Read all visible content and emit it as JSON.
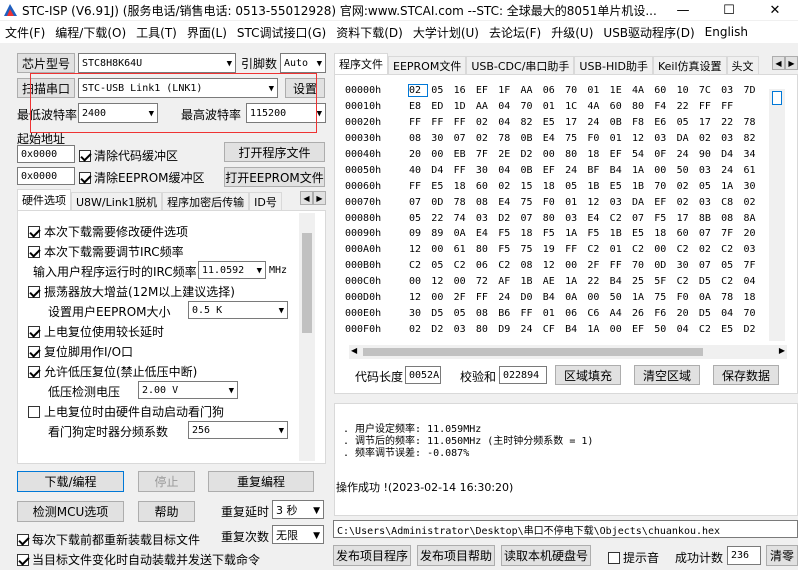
{
  "window": {
    "title": "STC-ISP (V6.91J) (服务电话/销售电话: 0513-55012928) 官网:www.STCAI.com  --STC: 全球最大的8051单片机设..."
  },
  "menu": [
    "文件(F)",
    "编程/下载(O)",
    "工具(T)",
    "界面(L)",
    "STC调试接口(G)",
    "资料下载(D)",
    "大学计划(U)",
    "去论坛(F)",
    "升级(U)",
    "USB驱动程序(D)",
    "English"
  ],
  "left": {
    "chip_model_btn": "芯片型号",
    "chip_model_value": "STC8H8K64U",
    "pin_count_label": "引脚数",
    "pin_count_value": "Auto",
    "scan_port_btn": "扫描串口",
    "port_value": "STC-USB Link1 (LNK1)",
    "settings_btn": "设置",
    "min_baud_label": "最低波特率",
    "min_baud_value": "2400",
    "max_baud_label": "最高波特率",
    "max_baud_value": "115200",
    "start_addr_label": "起始地址",
    "code_addr_value": "0x0000",
    "clear_code_label": "清除代码缓冲区",
    "open_program_btn": "打开程序文件",
    "eeprom_addr_value": "0x0000",
    "clear_eeprom_label": "清除EEPROM缓冲区",
    "open_eeprom_btn": "打开EEPROM文件"
  },
  "hw_tabs": [
    "硬件选项",
    "U8W/Link1脱机",
    "程序加密后传输",
    "ID号"
  ],
  "hw_options": {
    "opt1": "本次下载需要修改硬件选项",
    "opt2": "本次下载需要调节IRC频率",
    "irc_label": "输入用户程序运行时的IRC频率",
    "irc_value": "11.0592",
    "irc_unit": "MHz",
    "opt3": "振荡器放大增益(12M以上建议选择)",
    "eeprom_size_label": "设置用户EEPROM大小",
    "eeprom_size_value": "0.5 K",
    "opt4": "上电复位使用较长延时",
    "opt5": "复位脚用作I/O口",
    "opt6": "允许低压复位(禁止低压中断)",
    "lvd_label": "低压检测电压",
    "lvd_value": "2.00 V",
    "opt7": "上电复位时由硬件自动启动看门狗",
    "wdt_label": "看门狗定时器分频系数",
    "wdt_value": "256"
  },
  "bottom_left": {
    "download_btn": "下载/编程",
    "stop_btn": "停止",
    "reprogram_btn": "重复编程",
    "detect_btn": "检测MCU选项",
    "help_btn": "帮助",
    "repeat_delay_label": "重复延时",
    "repeat_delay_value": "3 秒",
    "repeat_count_label": "重复次数",
    "repeat_count_value": "无限",
    "reload_label": "每次下载前都重新装载目标文件",
    "auto_send_label": "当目标文件变化时自动装载并发送下载命令"
  },
  "right_tabs": [
    "程序文件",
    "EEPROM文件",
    "USB-CDC/串口助手",
    "USB-HID助手",
    "Keil仿真设置",
    "头文"
  ],
  "hex": {
    "rows": [
      {
        "addr": "00000h",
        "bytes": [
          "02",
          "05",
          "16",
          "EF",
          "1F",
          "AA",
          "06",
          "70",
          "01",
          "1E",
          "4A",
          "60",
          "10",
          "7C",
          "03",
          "7D"
        ]
      },
      {
        "addr": "00010h",
        "bytes": [
          "E8",
          "ED",
          "1D",
          "AA",
          "04",
          "70",
          "01",
          "1C",
          "4A",
          "60",
          "80",
          "F4",
          "22",
          "FF",
          "FF",
          ""
        ]
      },
      {
        "addr": "00020h",
        "bytes": [
          "FF",
          "FF",
          "FF",
          "02",
          "04",
          "82",
          "E5",
          "17",
          "24",
          "0B",
          "F8",
          "E6",
          "05",
          "17",
          "22",
          "78"
        ]
      },
      {
        "addr": "00030h",
        "bytes": [
          "08",
          "30",
          "07",
          "02",
          "78",
          "0B",
          "E4",
          "75",
          "F0",
          "01",
          "12",
          "03",
          "DA",
          "02",
          "03",
          "82"
        ]
      },
      {
        "addr": "00040h",
        "bytes": [
          "20",
          "00",
          "EB",
          "7F",
          "2E",
          "D2",
          "00",
          "80",
          "18",
          "EF",
          "54",
          "0F",
          "24",
          "90",
          "D4",
          "34"
        ]
      },
      {
        "addr": "00050h",
        "bytes": [
          "40",
          "D4",
          "FF",
          "30",
          "04",
          "0B",
          "EF",
          "24",
          "BF",
          "B4",
          "1A",
          "00",
          "50",
          "03",
          "24",
          "61"
        ]
      },
      {
        "addr": "00060h",
        "bytes": [
          "FF",
          "E5",
          "18",
          "60",
          "02",
          "15",
          "18",
          "05",
          "1B",
          "E5",
          "1B",
          "70",
          "02",
          "05",
          "1A",
          "30"
        ]
      },
      {
        "addr": "00070h",
        "bytes": [
          "07",
          "0D",
          "78",
          "08",
          "E4",
          "75",
          "F0",
          "01",
          "12",
          "03",
          "DA",
          "EF",
          "02",
          "03",
          "C8",
          "02"
        ]
      },
      {
        "addr": "00080h",
        "bytes": [
          "05",
          "22",
          "74",
          "03",
          "D2",
          "07",
          "80",
          "03",
          "E4",
          "C2",
          "07",
          "F5",
          "17",
          "8B",
          "08",
          "8A"
        ]
      },
      {
        "addr": "00090h",
        "bytes": [
          "09",
          "89",
          "0A",
          "E4",
          "F5",
          "18",
          "F5",
          "1A",
          "F5",
          "1B",
          "E5",
          "18",
          "60",
          "07",
          "7F",
          "20"
        ]
      },
      {
        "addr": "000A0h",
        "bytes": [
          "12",
          "00",
          "61",
          "80",
          "F5",
          "75",
          "19",
          "FF",
          "C2",
          "01",
          "C2",
          "00",
          "C2",
          "02",
          "C2",
          "03"
        ]
      },
      {
        "addr": "000B0h",
        "bytes": [
          "C2",
          "05",
          "C2",
          "06",
          "C2",
          "08",
          "12",
          "00",
          "2F",
          "FF",
          "70",
          "0D",
          "30",
          "07",
          "05",
          "7F"
        ]
      },
      {
        "addr": "000C0h",
        "bytes": [
          "00",
          "12",
          "00",
          "72",
          "AF",
          "1B",
          "AE",
          "1A",
          "22",
          "B4",
          "25",
          "5F",
          "C2",
          "D5",
          "C2",
          "04"
        ]
      },
      {
        "addr": "000D0h",
        "bytes": [
          "12",
          "00",
          "2F",
          "FF",
          "24",
          "D0",
          "B4",
          "0A",
          "00",
          "50",
          "1A",
          "75",
          "F0",
          "0A",
          "78",
          "18"
        ]
      },
      {
        "addr": "000E0h",
        "bytes": [
          "30",
          "D5",
          "05",
          "08",
          "B6",
          "FF",
          "01",
          "06",
          "C6",
          "A4",
          "26",
          "F6",
          "20",
          "D5",
          "04",
          "70"
        ]
      },
      {
        "addr": "000F0h",
        "bytes": [
          "02",
          "D2",
          "03",
          "80",
          "D9",
          "24",
          "CF",
          "B4",
          "1A",
          "00",
          "EF",
          "50",
          "04",
          "C2",
          "E5",
          "D2"
        ]
      }
    ]
  },
  "code_bar": {
    "code_len_label": "代码长度",
    "code_len_value": "0052A",
    "checksum_label": "校验和",
    "checksum_value": "022894",
    "fill_btn": "区域填充",
    "clear_btn": "清空区域",
    "save_btn": "保存数据"
  },
  "log": {
    "line1": ". 用户设定频率: 11.059MHz",
    "line2": ". 调节后的频率: 11.050MHz (主时钟分频系数 = 1)",
    "line3": ". 频率调节误差: -0.087%",
    "line4": "操作成功 !(2023-02-14 16:30:20)"
  },
  "path": "C:\\Users\\Administrator\\Desktop\\串口不停电下载\\Objects\\chuankou.hex",
  "bottom_bar": {
    "publish_prog_btn": "发布项目程序",
    "publish_help_btn": "发布项目帮助",
    "read_disk_btn": "读取本机硬盘号",
    "beep_label": "提示音",
    "success_label": "成功计数",
    "success_value": "236",
    "clear_btn": "清零"
  }
}
